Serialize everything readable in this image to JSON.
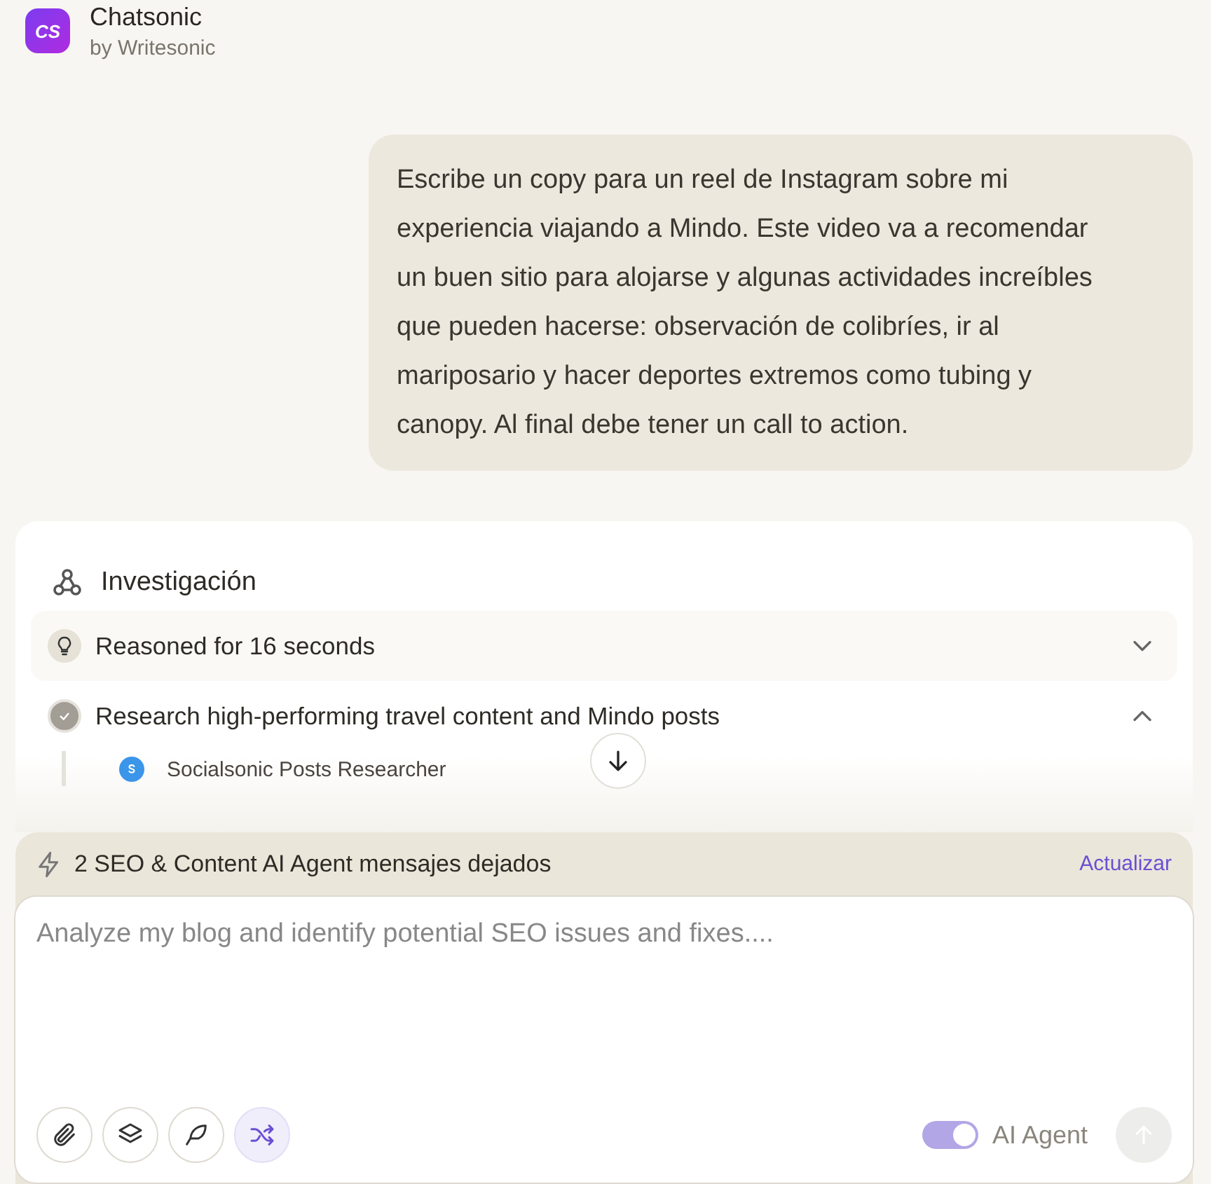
{
  "app": {
    "title": "Chatsonic",
    "subtitle": "by Writesonic",
    "logo": "CS"
  },
  "user_message": "Escribe un copy para un reel de Instagram sobre mi experiencia viajando a Mindo. Este video va a recomendar un buen sitio para alojarse y algunas actividades increíbles que pueden hacerse: observación de colibríes, ir al mariposario y hacer deportes extremos como tubing y canopy. Al final debe tener un call to action.",
  "research": {
    "title": "Investigación",
    "steps": [
      {
        "kind": "reasoning",
        "label": "Reasoned for 16 seconds",
        "expanded": false
      },
      {
        "kind": "done",
        "label": "Research high-performing travel content and Mindo posts",
        "expanded": true,
        "children": [
          {
            "label": "Socialsonic Posts Researcher"
          }
        ]
      }
    ]
  },
  "composer": {
    "quota": "2 SEO & Content AI Agent mensajes dejados",
    "upgrade": "Actualizar",
    "placeholder": "Analyze my blog and identify potential SEO issues and fixes....",
    "tools": [
      {
        "kind": "attach",
        "selected": false
      },
      {
        "kind": "layers",
        "selected": false
      },
      {
        "kind": "feather",
        "selected": false
      },
      {
        "kind": "shuffle",
        "selected": true
      }
    ],
    "agent_toggle": {
      "label": "AI Agent",
      "on": true
    },
    "send_disabled": true
  }
}
